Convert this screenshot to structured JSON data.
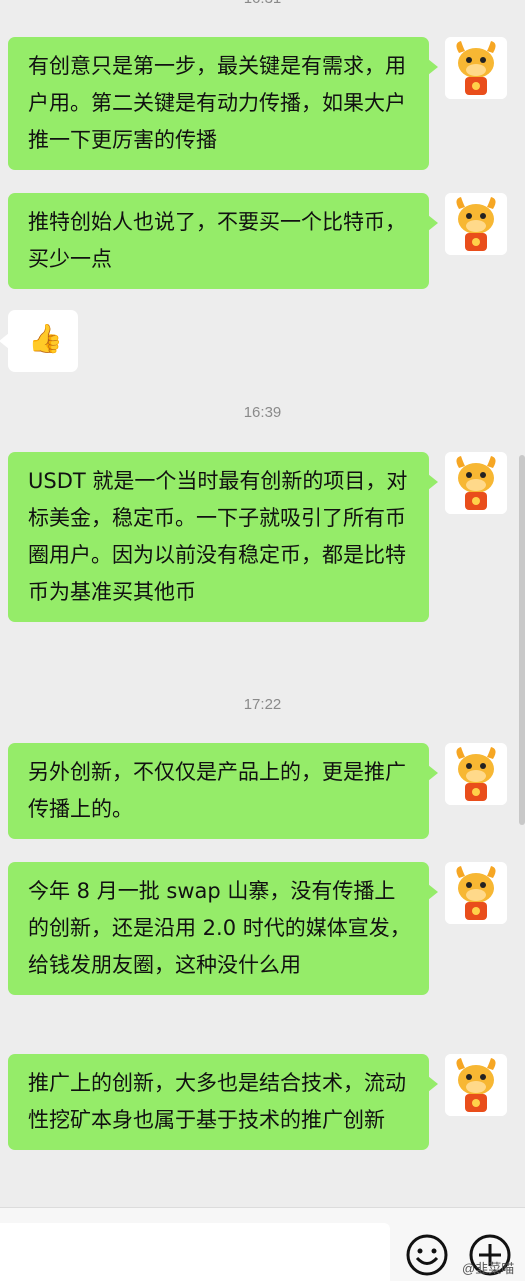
{
  "timestamps": [
    "16:39",
    "17:22"
  ],
  "messages": [
    {
      "text": "有创意只是第一步，最关键是有需求，用户用。第二关键是有动力传播，如果大户推一下更厉害的传播"
    },
    {
      "text": "推特创始人也说了，不要买一个比特币，买少一点"
    },
    {
      "text": "USDT 就是一个当时最有创新的项目，对标美金，稳定币。一下子就吸引了所有币圈用户。因为以前没有稳定币，都是比特币为基准买其他币"
    },
    {
      "text": "另外创新，不仅仅是产品上的，更是推广传播上的。"
    },
    {
      "text": "今年 8 月一批 swap 山寨，没有传播上的创新，还是沿用 2.0 时代的媒体宣发，给钱发朋友圈，这种没什么用"
    },
    {
      "text": "推广上的创新，大多也是结合技术，流动性挖矿本身也属于基于技术的推广创新"
    }
  ],
  "reaction": {
    "emoji": "👍"
  },
  "input_bar": {
    "emoji_icon": "smiley-icon",
    "plus_icon": "plus-icon"
  },
  "watermark": "@韭菜喵"
}
